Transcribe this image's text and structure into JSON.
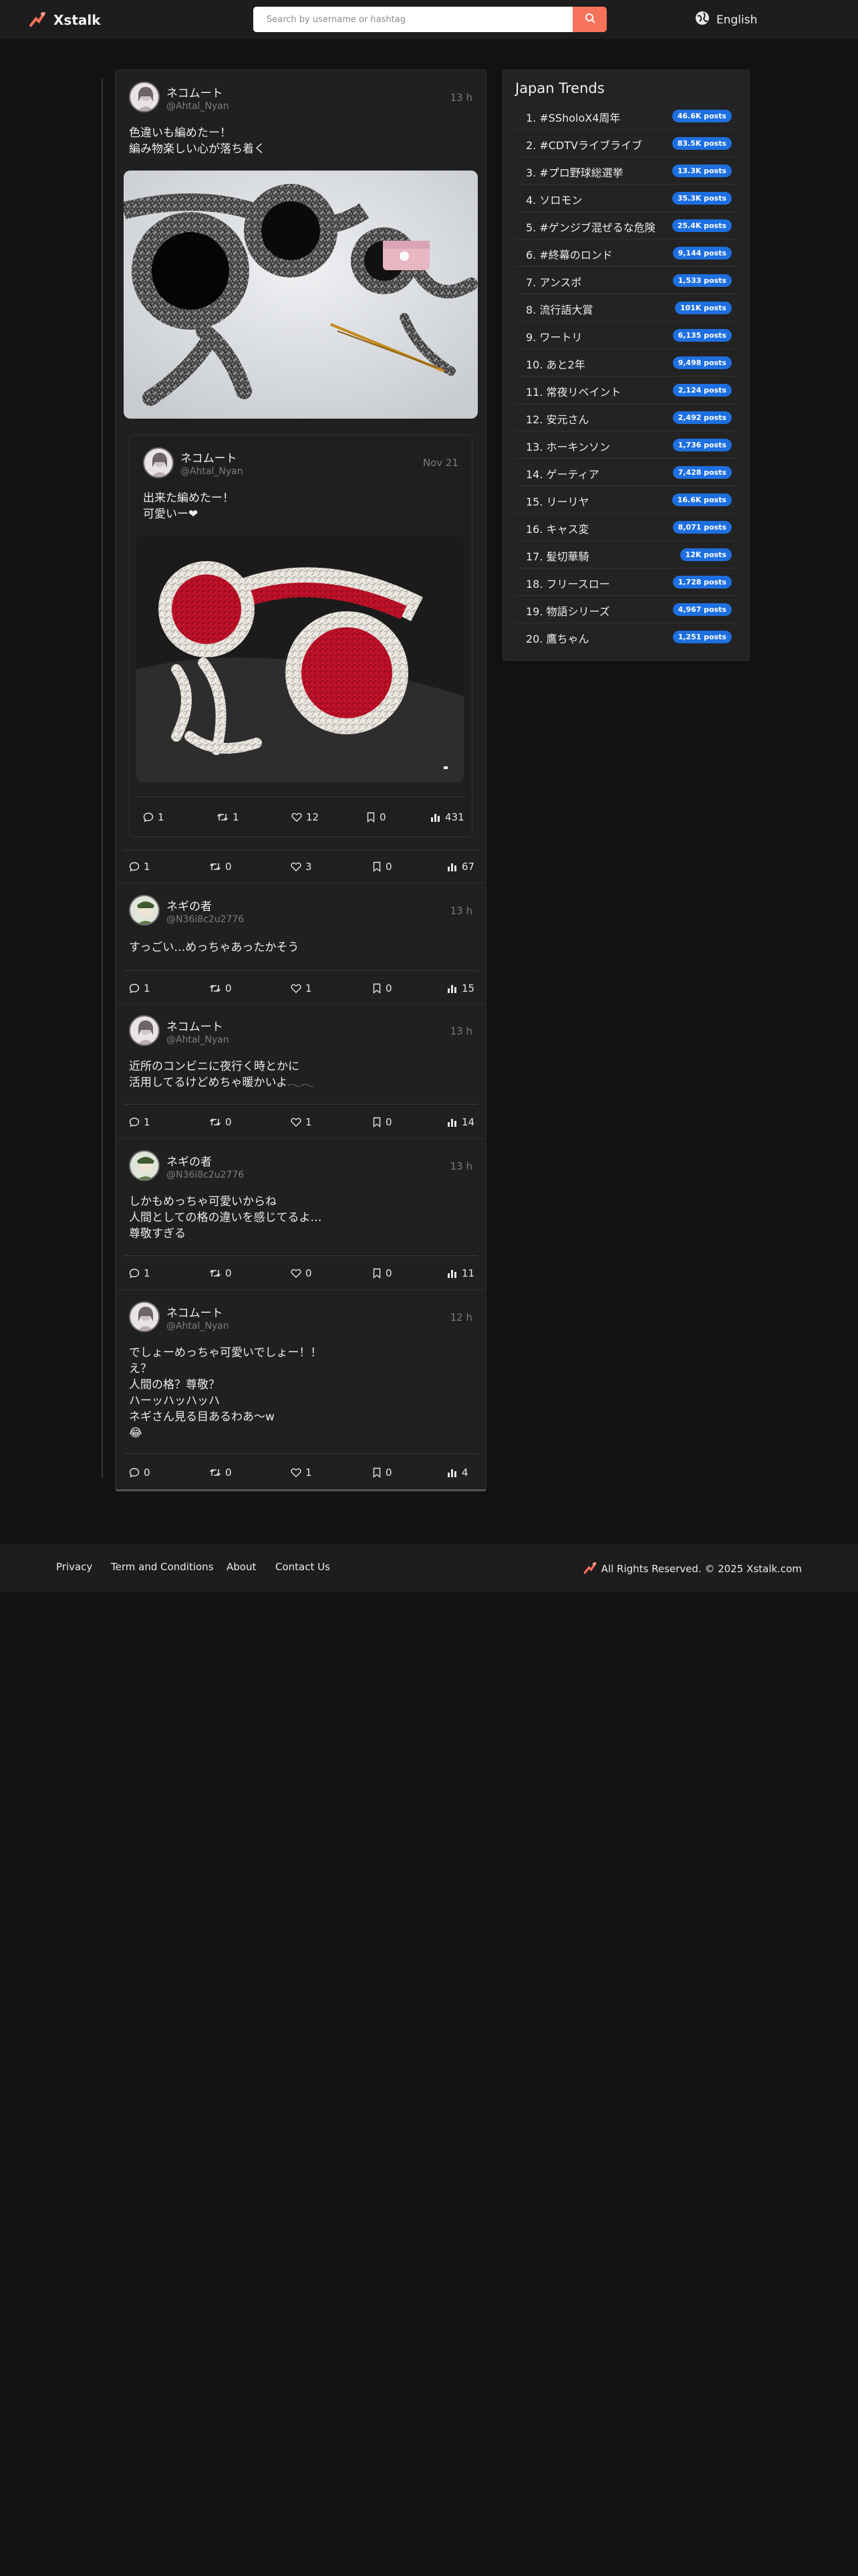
{
  "header": {
    "logo_text": "Xstalk",
    "search_placeholder": "Search by username or hashtag",
    "language": "English"
  },
  "posts": [
    {
      "name": "ネコムート",
      "handle": "@Ahtal_Nyan",
      "time": "13 h",
      "text": "色違いも編めたー！\n編み物楽しい心が落ち着く",
      "image": "knitted black and grey fuzzy ear muffs with yarn and crochet hook",
      "quote": {
        "name": "ネコムート",
        "handle": "@Ahtal_Nyan",
        "time": "Nov 21",
        "text": "出来た編めたー！\n可愛いー❤",
        "image": "knitted red and white fuzzy ear muffs",
        "replies": "1",
        "reposts": "1",
        "likes": "12",
        "bookmarks": "0",
        "views": "431"
      },
      "replies": "1",
      "reposts": "0",
      "likes": "3",
      "bookmarks": "0",
      "views": "67"
    },
    {
      "name": "ネギの者",
      "handle": "@N36i8c2u2776",
      "time": "13 h",
      "text": "すっごい…めっちゃあったかそう",
      "replies": "1",
      "reposts": "0",
      "likes": "1",
      "bookmarks": "0",
      "views": "15"
    },
    {
      "name": "ネコムート",
      "handle": "@Ahtal_Nyan",
      "time": "13 h",
      "text": "近所のコンビニに夜行く時とかに\n活用してるけどめちゃ暖かいよ𓂃𓂃",
      "replies": "1",
      "reposts": "0",
      "likes": "1",
      "bookmarks": "0",
      "views": "14"
    },
    {
      "name": "ネギの者",
      "handle": "@N36i8c2u2776",
      "time": "13 h",
      "text": "しかもめっちゃ可愛いからね\n人間としての格の違いを感じてるよ…\n尊敬すぎる",
      "replies": "1",
      "reposts": "0",
      "likes": "0",
      "bookmarks": "0",
      "views": "11"
    },
    {
      "name": "ネコムート",
      "handle": "@Ahtal_Nyan",
      "time": "12 h",
      "text": "でしょーめっちゃ可愛いでしょー！！\nえ？\n人間の格？尊敬？\nハーッハッハッハ\nネギさん見る目あるわあ〜w\n😂",
      "replies": "0",
      "reposts": "0",
      "likes": "1",
      "bookmarks": "0",
      "views": "4"
    }
  ],
  "trends": {
    "title": "Japan Trends",
    "items": [
      {
        "label": "1. #SSholoX4周年",
        "count": "46.6K posts"
      },
      {
        "label": "2. #CDTVライブライブ",
        "count": "83.5K posts"
      },
      {
        "label": "3. #プロ野球総選挙",
        "count": "13.3K posts"
      },
      {
        "label": "4. ソロモン",
        "count": "35.3K posts"
      },
      {
        "label": "5. #ゲンジブ混ぜるな危険",
        "count": "25.4K posts"
      },
      {
        "label": "6. #終幕のロンド",
        "count": "9,144 posts"
      },
      {
        "label": "7. アンスポ",
        "count": "1,533 posts"
      },
      {
        "label": "8. 流行語大賞",
        "count": "101K posts"
      },
      {
        "label": "9. ワートリ",
        "count": "6,135 posts"
      },
      {
        "label": "10. あと2年",
        "count": "9,498 posts"
      },
      {
        "label": "11. 常夜リベイント",
        "count": "2,124 posts"
      },
      {
        "label": "12. 安元さん",
        "count": "2,492 posts"
      },
      {
        "label": "13. ホーキンソン",
        "count": "1,736 posts"
      },
      {
        "label": "14. ゲーティア",
        "count": "7,428 posts"
      },
      {
        "label": "15. リーリヤ",
        "count": "16.6K posts"
      },
      {
        "label": "16. キャス変",
        "count": "8,071 posts"
      },
      {
        "label": "17. 髪切華騎",
        "count": "12K posts"
      },
      {
        "label": "18. フリースロー",
        "count": "1,728 posts"
      },
      {
        "label": "19. 物語シリーズ",
        "count": "4,967 posts"
      },
      {
        "label": "20. 鷹ちゃん",
        "count": "1,251 posts"
      }
    ]
  },
  "footer": {
    "links": [
      "Privacy",
      "Term and Conditions",
      "About",
      "Contact Us"
    ],
    "copyright": "All Rights Reserved. © 2025 Xstalk.com"
  },
  "colors": {
    "background": "#121212",
    "header": "#1d1d1d",
    "accent": "#f7725a",
    "badge": "#1e6fe0"
  }
}
